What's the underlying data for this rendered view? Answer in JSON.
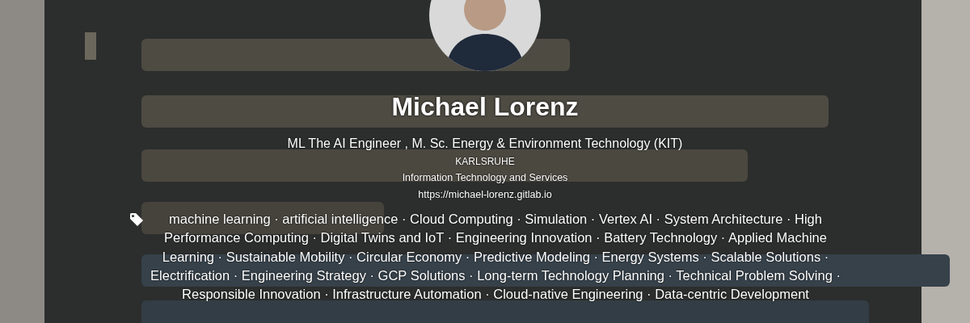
{
  "profile": {
    "name": "Michael Lorenz",
    "headline": "ML The AI Engineer , M. Sc. Energy & Environment Technology (KIT)",
    "location": "KARLSRUHE",
    "industry": "Information Technology and Services",
    "website": "https://michael-lorenz.gitlab.io"
  },
  "skills": {
    "separator": "·",
    "items": [
      "machine learning",
      "artificial intelligence",
      "Cloud Computing",
      "Simulation",
      "Vertex AI",
      "System Architecture",
      "High Performance Computing",
      "Digital Twins and IoT",
      "Engineering Innovation",
      "Battery Technology",
      "Applied Machine Learning",
      "Sustainable Mobility",
      "Circular Economy",
      "Predictive Modeling",
      "Energy Systems",
      "Scalable Solutions",
      "Electrification",
      "Engineering Strategy",
      "GCP Solutions",
      "Long-term Technology Planning",
      "Technical Problem Solving",
      "Responsible Innovation",
      "Infrastructure Automation",
      "Cloud-native Engineering",
      "Data-centric Development"
    ]
  }
}
